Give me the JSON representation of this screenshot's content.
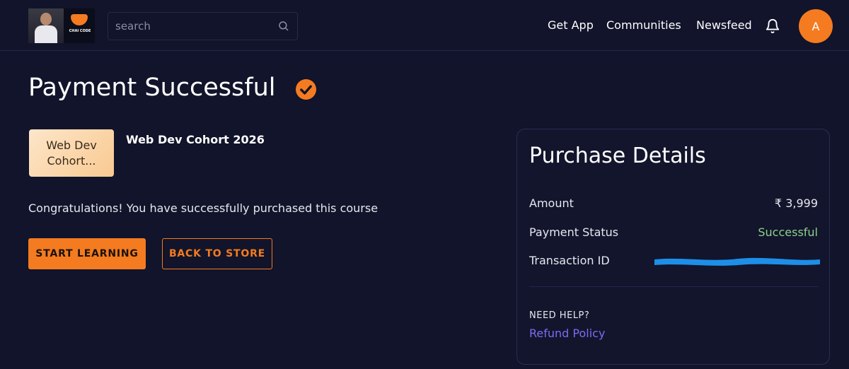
{
  "header": {
    "logo_text": "CHAI CODE",
    "search": {
      "placeholder": "search",
      "value": ""
    },
    "nav": {
      "get_app": "Get App",
      "communities": "Communities",
      "newsfeed": "Newsfeed"
    },
    "avatar_initial": "A"
  },
  "main": {
    "title": "Payment Successful",
    "course": {
      "thumbnail_text": "Web Dev Cohort...",
      "name": "Web Dev Cohort 2026"
    },
    "message": "Congratulations! You have successfully purchased this course",
    "buttons": {
      "start_learning": "START LEARNING",
      "back_to_store": "BACK TO STORE"
    }
  },
  "purchase_details": {
    "title": "Purchase Details",
    "amount_label": "Amount",
    "amount_value": "₹ 3,999",
    "status_label": "Payment Status",
    "status_value": "Successful",
    "transaction_label": "Transaction ID",
    "help_label": "NEED HELP?",
    "refund_link": "Refund Policy"
  },
  "colors": {
    "background": "#11142a",
    "accent": "#f47b20",
    "success": "#8fd08a",
    "link": "#7b6cf2",
    "redaction": "#1e8fe8"
  },
  "icons": [
    "search-icon",
    "bell-icon",
    "verified-check-icon"
  ]
}
